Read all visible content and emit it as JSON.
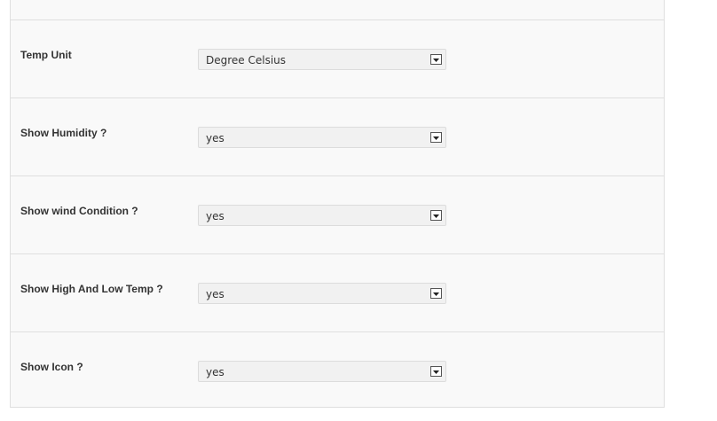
{
  "settings": {
    "rows": [
      {
        "label": "Temp Unit",
        "value": "Degree Celsius"
      },
      {
        "label": "Show Humidity ?",
        "value": "yes"
      },
      {
        "label": "Show wind Condition ?",
        "value": "yes"
      },
      {
        "label": "Show High And Low Temp ?",
        "value": "yes"
      },
      {
        "label": "Show Icon ?",
        "value": "yes"
      }
    ]
  },
  "icons": {
    "dropdown": "chevron-down-icon"
  }
}
